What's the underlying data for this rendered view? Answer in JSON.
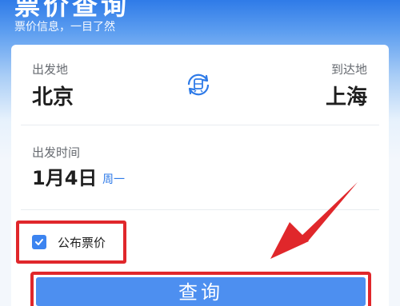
{
  "header": {
    "title": "票价查询",
    "subtitle": "票价信息，一目了然"
  },
  "route": {
    "from_label": "出发地",
    "from_city": "北京",
    "to_label": "到达地",
    "to_city": "上海",
    "swap_icon": "railway-swap-icon"
  },
  "date": {
    "label": "出发时间",
    "value": "1月4日",
    "weekday": "周一"
  },
  "options": {
    "public_fare_label": "公布票价",
    "public_fare_checked": true
  },
  "actions": {
    "query_label": "查询"
  },
  "colors": {
    "accent": "#2f7be8",
    "button": "#4d8ff0",
    "annotation_red": "#e0272b"
  }
}
